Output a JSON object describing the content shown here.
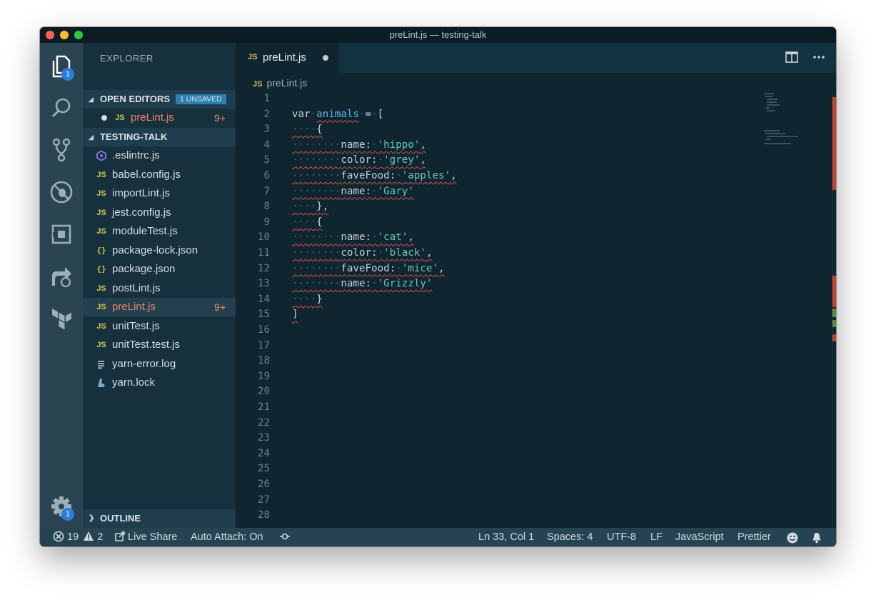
{
  "window": {
    "title": "preLint.js — testing-talk"
  },
  "activity_bar": {
    "explorer_badge": "1",
    "settings_badge": "1",
    "icons": [
      "files-icon",
      "search-icon",
      "source-control-icon",
      "debug-icon",
      "extensions-icon",
      "live-share-icon",
      "terraform-icon",
      "gear-icon"
    ]
  },
  "sidebar": {
    "title": "EXPLORER",
    "open_editors": {
      "label": "OPEN EDITORS",
      "badge": "1 UNSAVED",
      "items": [
        {
          "icon": "JS",
          "name": "preLint.js",
          "problems": "9+"
        }
      ]
    },
    "folder": {
      "label": "TESTING-TALK",
      "files": [
        {
          "icon": "eslint",
          "name": ".eslintrc.js",
          "problems": ""
        },
        {
          "icon": "JS",
          "name": "babel.config.js",
          "problems": ""
        },
        {
          "icon": "JS",
          "name": "importLint.js",
          "problems": ""
        },
        {
          "icon": "JS",
          "name": "jest.config.js",
          "problems": ""
        },
        {
          "icon": "JS",
          "name": "moduleTest.js",
          "problems": ""
        },
        {
          "icon": "{}",
          "name": "package-lock.json",
          "problems": ""
        },
        {
          "icon": "{}",
          "name": "package.json",
          "problems": ""
        },
        {
          "icon": "JS",
          "name": "postLint.js",
          "problems": ""
        },
        {
          "icon": "JS",
          "name": "preLint.js",
          "problems": "9+"
        },
        {
          "icon": "JS",
          "name": "unitTest.js",
          "problems": ""
        },
        {
          "icon": "JS",
          "name": "unitTest.test.js",
          "problems": ""
        },
        {
          "icon": "log",
          "name": "yarn-error.log",
          "problems": ""
        },
        {
          "icon": "yarn",
          "name": "yarn.lock",
          "problems": ""
        }
      ]
    },
    "outline": {
      "label": "OUTLINE"
    }
  },
  "editor": {
    "tab": {
      "icon": "JS",
      "name": "preLint.js"
    },
    "breadcrumb": {
      "icon": "JS",
      "name": "preLint.js"
    },
    "line_numbers": [
      "1",
      "2",
      "3",
      "4",
      "5",
      "6",
      "7",
      "8",
      "9",
      "10",
      "11",
      "12",
      "13",
      "14",
      "15",
      "16",
      "17",
      "18",
      "19",
      "20",
      "21",
      "22",
      "23",
      "24",
      "25",
      "26",
      "27",
      "28"
    ],
    "code": {
      "l2_kw": "var",
      "l2_var": "animals",
      "l2_op": "=",
      "l2_br": "[",
      "brace_open": "{",
      "brace_close": "},",
      "brace_close_last": "}",
      "bracket_close": "]",
      "k_name": "name:",
      "k_color": "color:",
      "k_fave": "faveFood:",
      "v_hippo": "'hippo'",
      "v_grey": "'grey'",
      "v_apples": "'apples'",
      "v_gary": "'Gary'",
      "v_cat": "'cat'",
      "v_black": "'black'",
      "v_mice": "'mice'",
      "v_grizzly": "'Grizzly'",
      "comma": ","
    }
  },
  "statusbar": {
    "errors": "19",
    "warnings": "2",
    "live_share": "Live Share",
    "auto_attach": "Auto Attach: On",
    "position": "Ln 33, Col 1",
    "spaces": "Spaces: 4",
    "encoding": "UTF-8",
    "eol": "LF",
    "language": "JavaScript",
    "formatter": "Prettier"
  },
  "colors": {
    "editor_bg": "#0f2530",
    "sidebar_bg": "#16303d",
    "activity_bg": "#2a4452",
    "status_bg": "#254350",
    "badge_blue": "#2a7ed8",
    "error_squiggle": "#d8504a",
    "string": "#6fc7b1",
    "variable": "#5ab4ec",
    "js_icon": "#d4c652",
    "problem_count": "#e38a6c"
  }
}
